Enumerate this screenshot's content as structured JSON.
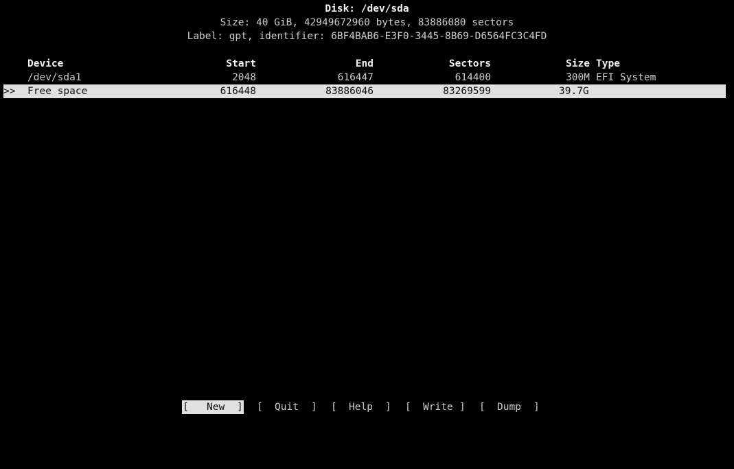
{
  "header": {
    "title": "Disk: /dev/sda",
    "size_line": "Size: 40 GiB, 42949672960 bytes, 83886080 sectors",
    "label_line": "Label: gpt, identifier: 6BF4BAB6-E3F0-3445-8B69-D6564FC3C4FD"
  },
  "table": {
    "columns": {
      "device": "Device",
      "start": "Start",
      "end": "End",
      "sectors": "Sectors",
      "size": "Size",
      "type": "Type"
    },
    "rows": [
      {
        "marker": "",
        "device": "/dev/sda1",
        "start": "2048",
        "end": "616447",
        "sectors": "614400",
        "size": "300M",
        "type": "EFI System",
        "selected": false
      },
      {
        "marker": ">>",
        "device": "Free space",
        "start": "616448",
        "end": "83886046",
        "sectors": "83269599",
        "size": "39.7G",
        "type": "",
        "selected": true
      }
    ]
  },
  "actions": {
    "open_bracket": "[",
    "close_bracket": "]",
    "buttons": [
      {
        "label": "New",
        "active": true
      },
      {
        "label": "Quit",
        "active": false
      },
      {
        "label": "Help",
        "active": false
      },
      {
        "label": "Write",
        "active": false
      },
      {
        "label": "Dump",
        "active": false
      }
    ]
  },
  "colors": {
    "background": "#000000",
    "foreground": "#cccccc",
    "highlight_bg": "#e0e0e0",
    "highlight_fg": "#0c0c0c"
  }
}
